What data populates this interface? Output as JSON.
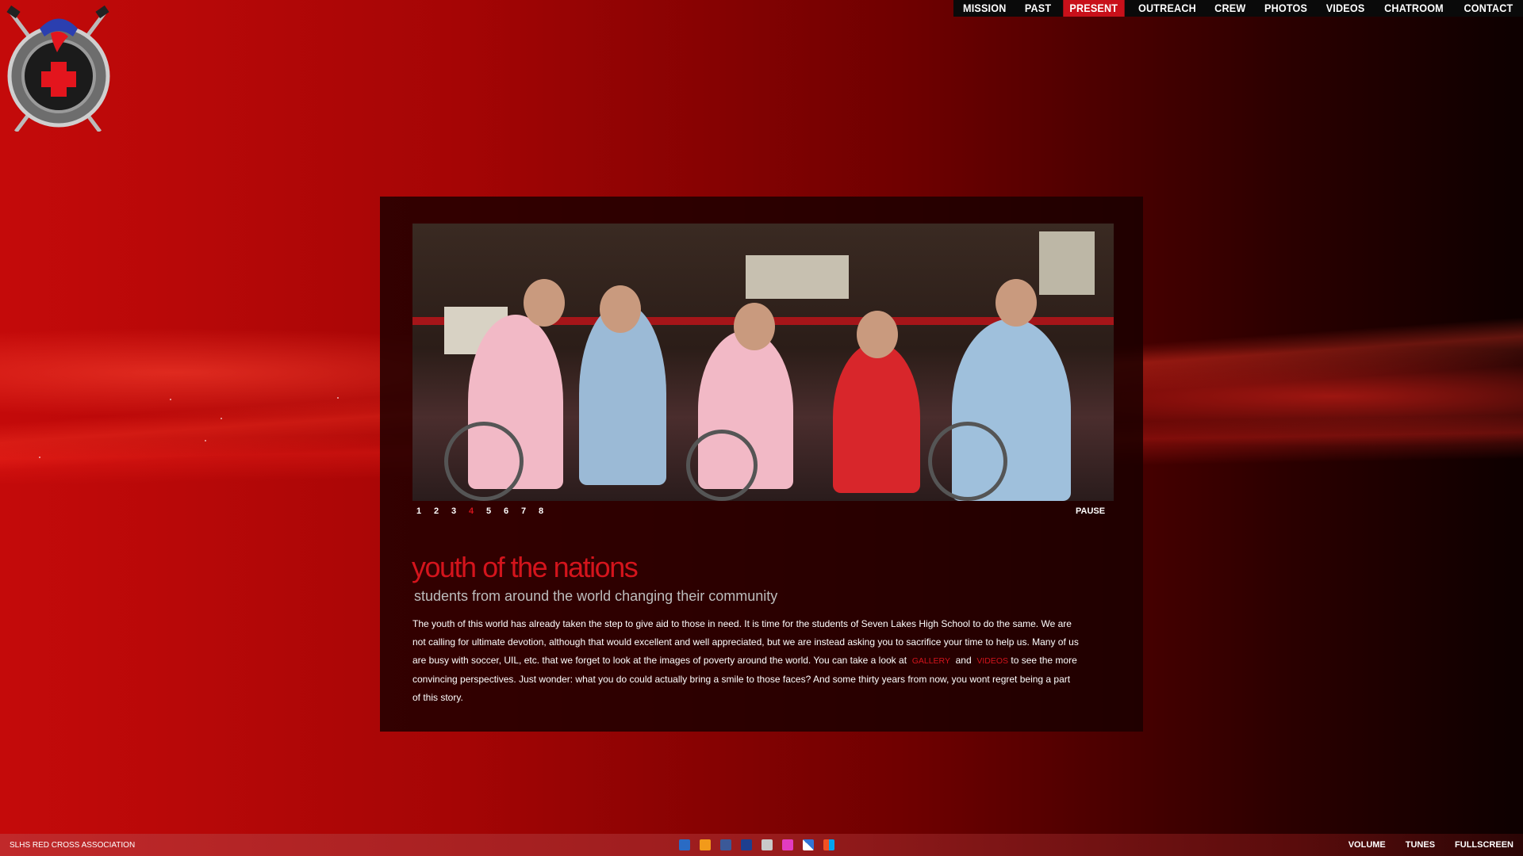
{
  "nav": {
    "items": [
      "MISSION",
      "PAST",
      "PRESENT",
      "OUTREACH",
      "CREW",
      "PHOTOS",
      "VIDEOS",
      "CHATROOM",
      "CONTACT"
    ],
    "active": "PRESENT"
  },
  "slideshow": {
    "pages": [
      "1",
      "2",
      "3",
      "4",
      "5",
      "6",
      "7",
      "8"
    ],
    "active_page": "4",
    "pause_label": "PAUSE"
  },
  "content": {
    "title": "youth of the nations",
    "subtitle": "students from around the world changing their community",
    "body_part1": "The youth of this world has already taken the step to give aid to those in need. It is time for the students of Seven Lakes High School to do the same. We are not calling for ultimate devotion, although that would excellent and well appreciated, but we are instead asking you to sacrifice your time to help us. Many of us are busy with soccer, UIL, etc. that we forget to look at the images of poverty around the world. You can take a look at",
    "link_gallery": "GALLERY",
    "and_text": "and",
    "link_videos": "VIDEOS",
    "body_part2": "to see the more convincing perspectives. Just wonder: what you do could actually bring a smile to those faces? And some thirty years from now, you wont regret being a part of this story."
  },
  "footer": {
    "brand": "SLHS RED CROSS ASSOCIATION",
    "social_icons": [
      "delicious-icon",
      "rss-icon",
      "facebook-icon",
      "myspace-icon",
      "digg-icon",
      "flickr-icon",
      "delicious-squares-icon",
      "windows-live-icon"
    ],
    "controls": [
      "VOLUME",
      "TUNES",
      "FULLSCREEN"
    ]
  },
  "colors": {
    "accent_red": "#d4141c",
    "panel_bg": "#190000",
    "nav_bg": "#0a0a0a"
  }
}
